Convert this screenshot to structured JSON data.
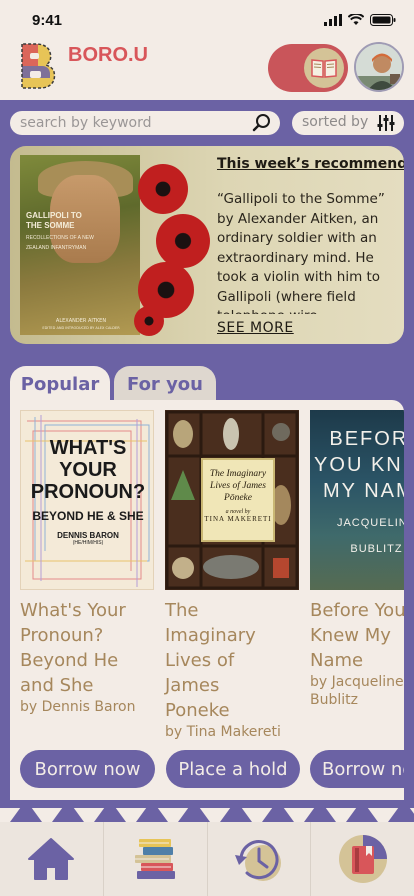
{
  "status_bar": {
    "time": "9:41"
  },
  "header": {
    "brand": "BORO.U"
  },
  "search": {
    "placeholder": "search by keyword",
    "sort_label": "sorted by"
  },
  "recommendation": {
    "heading": "This week’s recommend:",
    "description": "“Gallipoli to the Somme” by Alexander Aitken, an ordinary soldier with an extraordinary mind. He took a violin with him to Gallipoli (where field telephone wire",
    "see_more": "SEE MORE",
    "cover": {
      "title": "GALLIPOLI TO THE SOMME",
      "subtitle": "RECOLLECTIONS OF A NEW ZEALAND INFANTRYMAN",
      "author": "ALEXANDER AITKEN",
      "introduction": "EDITED AND INTRODUCED BY ALEX CALDER"
    }
  },
  "tabs": {
    "popular": "Popular",
    "for_you": "For you"
  },
  "books": [
    {
      "title_lines": [
        "What's Your",
        "Pronoun?",
        "Beyond He",
        "and She"
      ],
      "author": "by Dennis Baron",
      "action": "Borrow now",
      "cover": {
        "title": "WHAT'S YOUR PRONOUN?",
        "subtitle": "BEYOND HE & SHE",
        "author": "DENNIS BARON",
        "pronouns": "(HE/HIM/HIS)"
      }
    },
    {
      "title_lines": [
        "The",
        "Imaginary",
        "Lives of",
        "James",
        "Poneke"
      ],
      "author": "by Tina Makereti",
      "action": "Place a hold",
      "cover": {
        "title": "The Imaginary Lives of James Pōneke",
        "subtitle": "a novel by",
        "author": "TINA MAKERETI"
      }
    },
    {
      "title_lines": [
        "Before You",
        "Knew My",
        "Name"
      ],
      "author_lines": [
        "by Jacqueline",
        "Bublitz"
      ],
      "action": "Borrow now",
      "cover": {
        "title": "BEFORE YOU KNEW MY NAME",
        "author": "JACQUELINE BUBLITZ"
      }
    }
  ],
  "nav": [
    "home-icon",
    "books-stack-icon",
    "history-icon",
    "bookshelf-icon"
  ],
  "colors": {
    "primary": "#6b62a4",
    "background": "#f3ece6",
    "accent": "#d8565a",
    "text_brown": "#a6875c"
  }
}
